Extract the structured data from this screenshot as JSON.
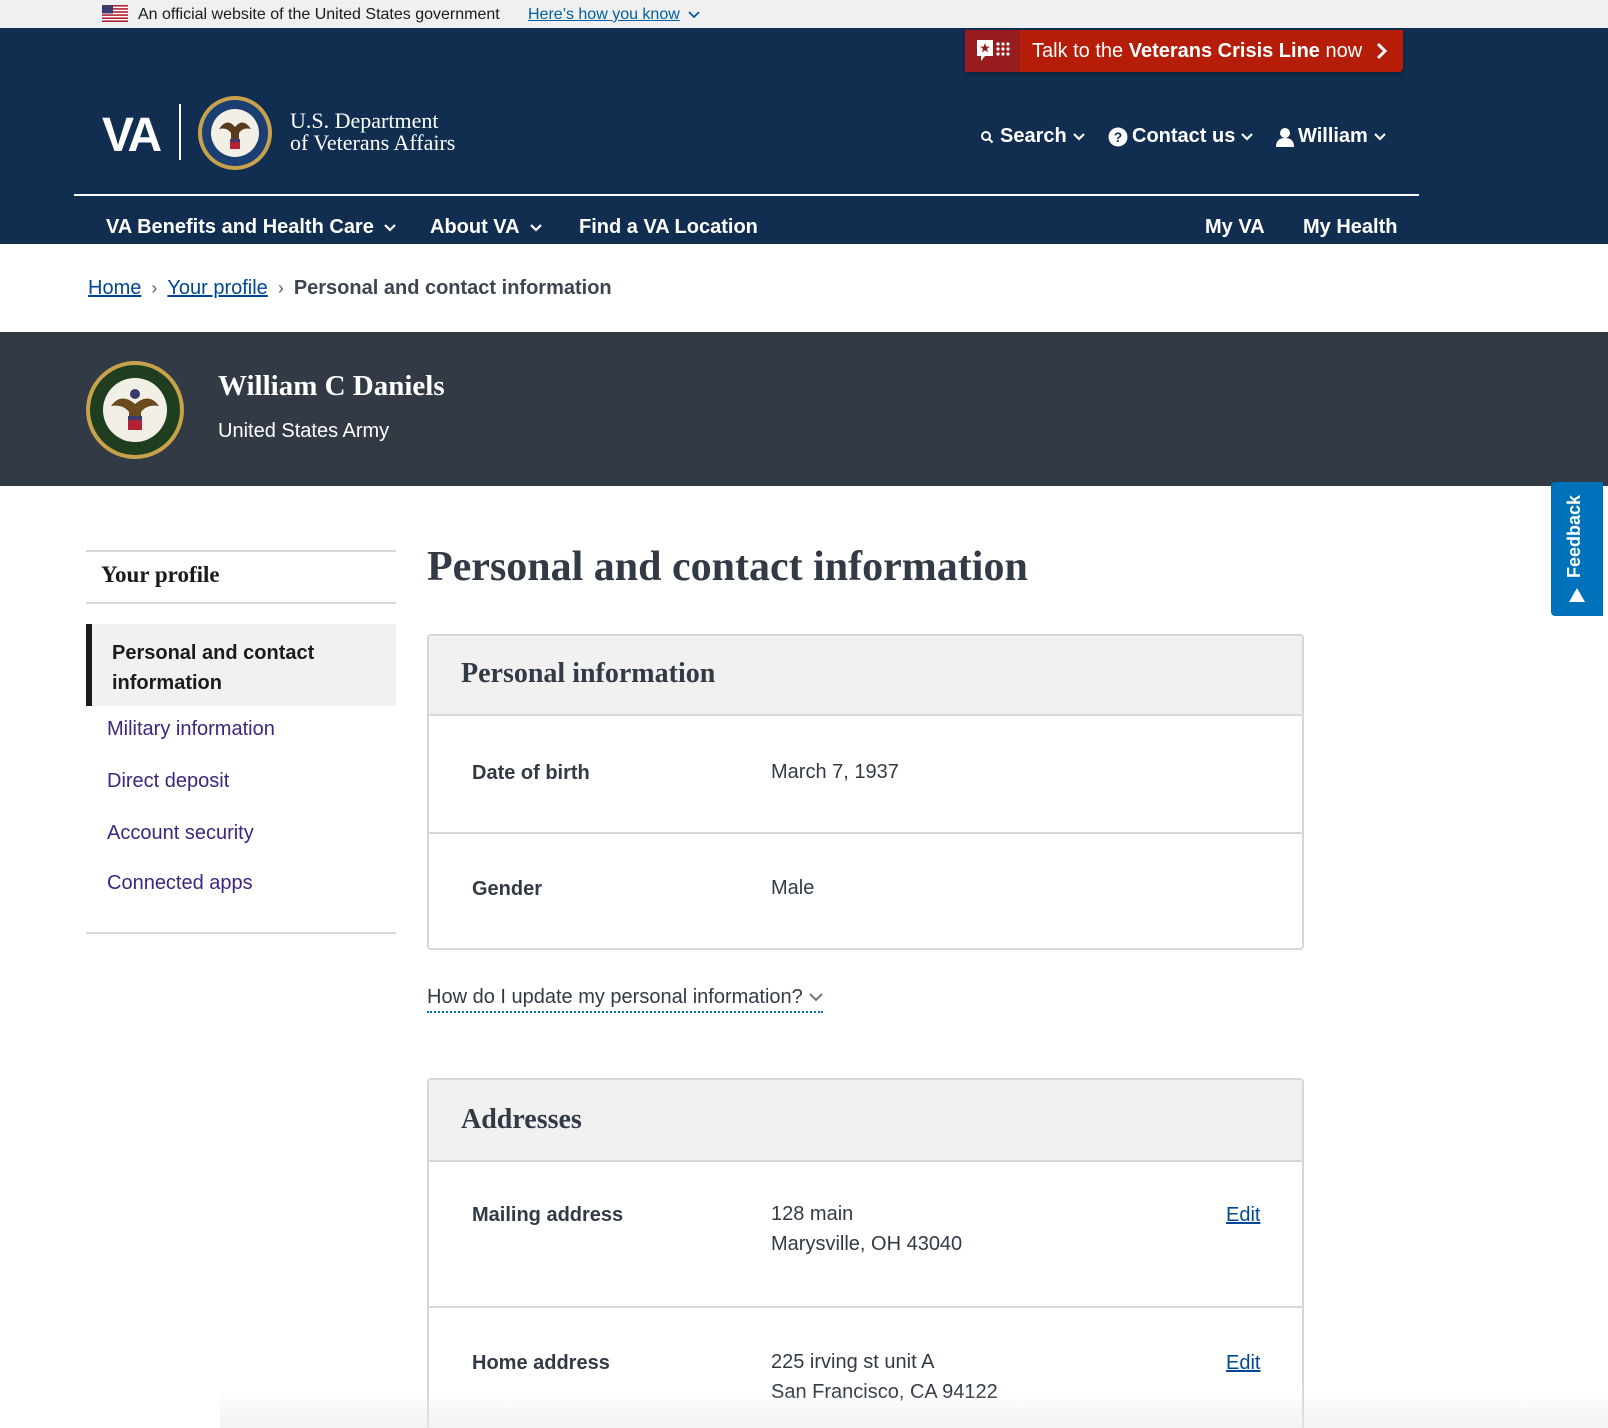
{
  "gov_banner": {
    "text": "An official website of the United States government",
    "link": "Here’s how you know",
    "flag_icon": "us-flag-icon"
  },
  "crisis_line": {
    "prefix": "Talk to the ",
    "bold": "Veterans Crisis Line",
    "suffix": " now",
    "icon": "crisis-line-icon",
    "accent": "#b51d09"
  },
  "header": {
    "logo": "VA",
    "dept_line1": "U.S. Department",
    "dept_line2": "of Veterans Affairs",
    "background": "#112e51",
    "utility": {
      "search": "Search",
      "contact": "Contact us",
      "user": "William"
    },
    "nav": {
      "benefits": "VA Benefits and Health Care",
      "about": "About VA",
      "find": "Find a VA Location",
      "my_va": "My VA",
      "my_health": "My Health"
    }
  },
  "breadcrumb": {
    "home": "Home",
    "profile": "Your profile",
    "current": "Personal and contact information",
    "separator": "›"
  },
  "hero": {
    "name": "William C Daniels",
    "branch": "United States Army",
    "background": "#323a45"
  },
  "feedback": {
    "label": "Feedback",
    "color": "#0071bb"
  },
  "sidenav": {
    "title": "Your profile",
    "active": "Personal and contact information",
    "items": [
      "Military information",
      "Direct deposit",
      "Account security",
      "Connected apps"
    ]
  },
  "main": {
    "title": "Personal and contact information",
    "personal": {
      "heading": "Personal information",
      "dob_label": "Date of birth",
      "dob_value": "March 7, 1937",
      "gender_label": "Gender",
      "gender_value": "Male"
    },
    "update_link": "How do I update my personal information?",
    "addresses": {
      "heading": "Addresses",
      "mailing_label": "Mailing address",
      "mailing_line1": "128 main",
      "mailing_line2": "Marysville, OH 43040",
      "home_label": "Home address",
      "home_line1": "225 irving st unit A",
      "home_line2": "San Francisco, CA 94122",
      "edit": "Edit"
    }
  }
}
